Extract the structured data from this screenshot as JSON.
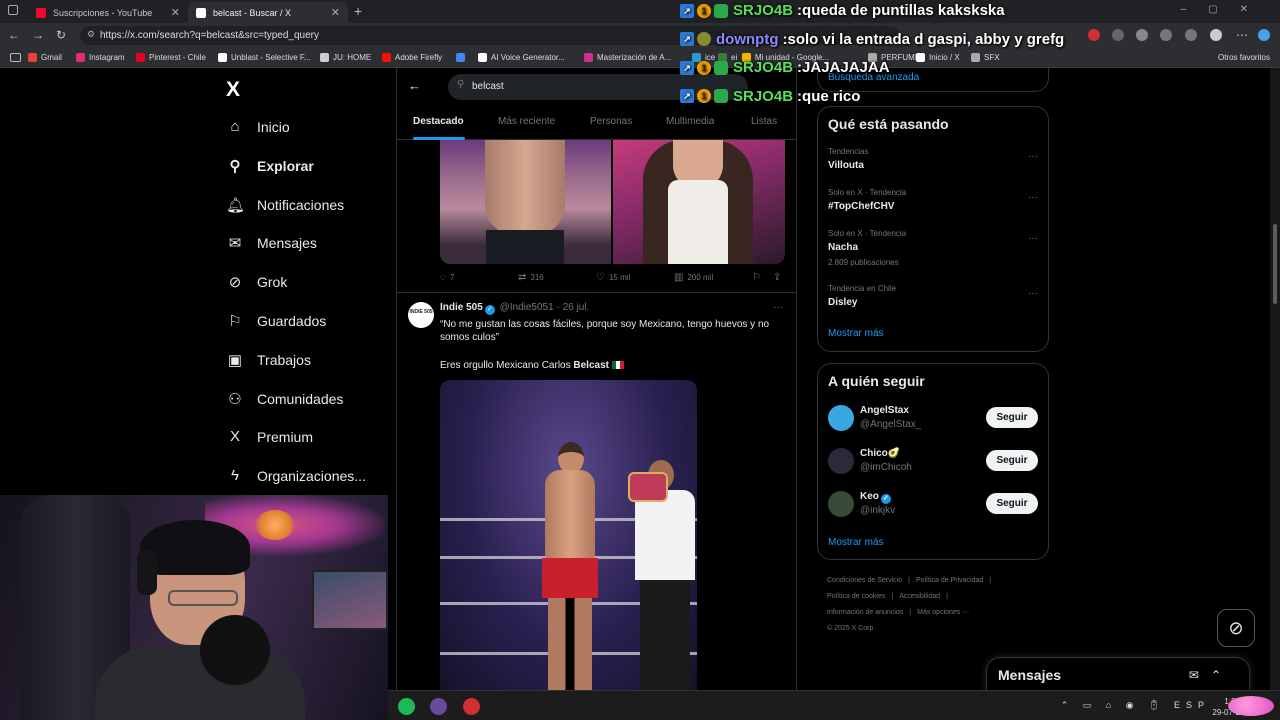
{
  "browser": {
    "tabs": [
      {
        "title": "Suscripciones - YouTube",
        "favicon_color": "#ff0033"
      },
      {
        "title": "belcast - Buscar / X",
        "favicon_color": "#ffffff"
      }
    ],
    "new_tab": "+",
    "url": "https://x.com/search?q=belcast&src=typed_query",
    "bookmarks": [
      {
        "label": "Gmail",
        "color": "#ea4335"
      },
      {
        "label": "Instagram",
        "color": "#e1306c"
      },
      {
        "label": "Pinterest - Chile",
        "color": "#e60023"
      },
      {
        "label": "Unblast - Selective F...",
        "color": "#ffffff"
      },
      {
        "label": "JU: HOME",
        "color": "#cccccc"
      },
      {
        "label": "Adobe Firefly",
        "color": "#fa0f00"
      },
      {
        "label": "",
        "color": "#4285f4"
      },
      {
        "label": "AI Voice Generator...",
        "color": "#ffffff"
      },
      {
        "label": "Masterización de A...",
        "color": "#d0308a"
      },
      {
        "label": "ice",
        "color": "#2a9ad0"
      },
      {
        "label": "ei",
        "color": "#3a7a3a"
      },
      {
        "label": "Mi unidad - Google...",
        "color": "#f4b400"
      },
      {
        "label": "PERFUMES",
        "color": "#aaaaaa"
      },
      {
        "label": "Inicio / X",
        "color": "#ffffff"
      },
      {
        "label": "SFX",
        "color": "#aaaaaa"
      }
    ],
    "bookmarks_others": "Otros favoritos"
  },
  "x": {
    "logo": "X",
    "nav": [
      {
        "label": "Inicio",
        "icon": "home-icon",
        "glyph": "⌂"
      },
      {
        "label": "Explorar",
        "icon": "search-icon",
        "glyph": "⚲"
      },
      {
        "label": "Notificaciones",
        "icon": "bell-icon",
        "glyph": "🔔︎"
      },
      {
        "label": "Mensajes",
        "icon": "envelope-icon",
        "glyph": "✉"
      },
      {
        "label": "Grok",
        "icon": "grok-icon",
        "glyph": "⊘"
      },
      {
        "label": "Guardados",
        "icon": "bookmark-icon",
        "glyph": "⚐"
      },
      {
        "label": "Trabajos",
        "icon": "briefcase-icon",
        "glyph": "▣"
      },
      {
        "label": "Comunidades",
        "icon": "people-icon",
        "glyph": "⚇"
      },
      {
        "label": "Premium",
        "icon": "x-premium-icon",
        "glyph": "X"
      },
      {
        "label": "Organizaciones...",
        "icon": "lightning-icon",
        "glyph": "ϟ"
      }
    ],
    "search": {
      "query": "belcast"
    },
    "search_tabs": [
      "Destacado",
      "Más reciente",
      "Personas",
      "Multimedia",
      "Listas"
    ],
    "post1_actions": {
      "replies": "7",
      "reposts": "316",
      "likes": "15 mil",
      "views": "200 mil"
    },
    "post2": {
      "avatar_text": "INDIE 505",
      "name": "Indie 505",
      "handle": "@Indie5051",
      "date": "26 jul.",
      "text": "“No me gustan las cosas fáciles, porque soy Mexicano, tengo huevos y no somos culos”",
      "text2_prefix": "Eres orgullo Mexicano Carlos ",
      "text2_bold": "Belcast"
    },
    "right": {
      "advanced_search": "Búsqueda avanzada",
      "trends_title": "Qué está pasando",
      "trends": [
        {
          "context": "Tendencias",
          "name": "Villouta",
          "count": ""
        },
        {
          "context": "Solo en X · Tendencia",
          "name": "#TopChefCHV",
          "count": ""
        },
        {
          "context": "Solo en X · Tendencia",
          "name": "Nacha",
          "count": "2.809 publicaciones"
        },
        {
          "context": "Tendencia en Chile",
          "name": "Disley",
          "count": ""
        }
      ],
      "trends_more": "Mostrar más",
      "follow_title": "A quién seguir",
      "follow": [
        {
          "name": "AngelStax",
          "handle": "@AngelStax_",
          "verified": false,
          "button": "Seguir",
          "avatar_color": "#38a8e0"
        },
        {
          "name": "Chico🥑",
          "handle": "@imChicoh",
          "verified": false,
          "button": "Seguir",
          "avatar_color": "#2a2a3a"
        },
        {
          "name": "Keo",
          "handle": "@inkjkv",
          "verified": true,
          "button": "Seguir",
          "avatar_color": "#3a4a3a"
        }
      ],
      "follow_more": "Mostrar más",
      "footer": [
        "Condiciones de Servicio",
        "|",
        "Política de Privacidad",
        "|",
        "Política de cookies",
        "|",
        "Accesibilidad",
        "|",
        "Información de anuncios",
        "|",
        "Más opciones ···",
        "© 2025 X Corp."
      ]
    },
    "messages_drawer": {
      "title": "Mensajes"
    }
  },
  "chat": [
    {
      "user": "SRJO4B",
      "color": "#57e05a",
      "message": "queda de puntillas kakskska",
      "badges": [
        "prime",
        "num"
      ]
    },
    {
      "user": "downptg",
      "color": "#8a8aff",
      "message": "solo vi la entrada d gaspi, abby y grefg",
      "badges": [
        "prime",
        "ce"
      ]
    },
    {
      "user": "SRJO4B",
      "color": "#57e05a",
      "message": "JAJAJAJAA",
      "badges": [
        "prime",
        "num"
      ]
    },
    {
      "user": "SRJO4B",
      "color": "#57e05a",
      "message": "que rico",
      "badges": [
        "prime",
        "num"
      ]
    }
  ],
  "taskbar": {
    "apps": [
      {
        "name": "spotify",
        "color": "#1db954"
      },
      {
        "name": "obs",
        "color": "#6a4aa0"
      },
      {
        "name": "app",
        "color": "#d03030"
      }
    ],
    "lang": "ESP",
    "time": "1:59",
    "date": "29-07-2"
  }
}
